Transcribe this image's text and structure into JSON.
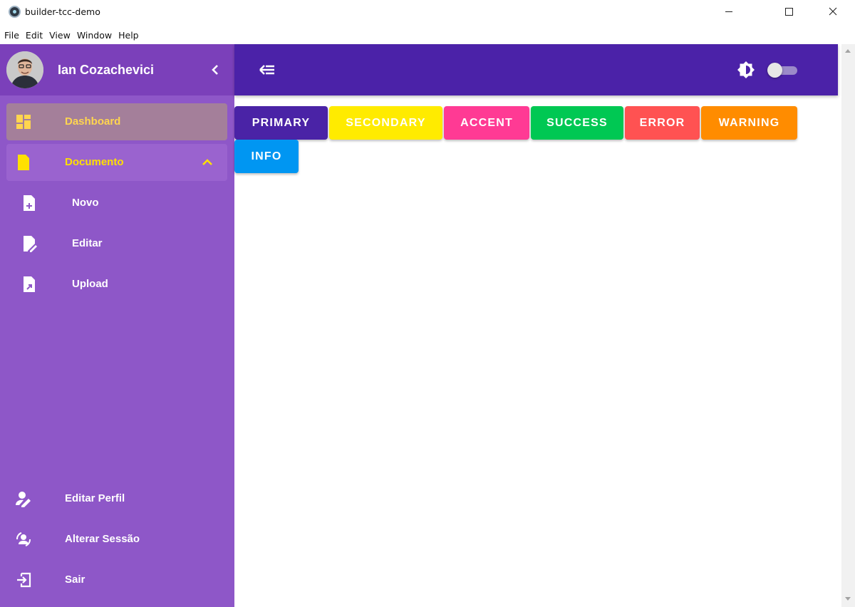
{
  "window": {
    "title": "builder-tcc-demo",
    "icon": "electron-icon"
  },
  "menubar": {
    "items": [
      "File",
      "Edit",
      "View",
      "Window",
      "Help"
    ]
  },
  "sidebar": {
    "user_name": "Ian Cozachevici",
    "items": [
      {
        "label": "Dashboard",
        "icon": "dashboard-icon",
        "state": "active"
      },
      {
        "label": "Documento",
        "icon": "document-icon",
        "state": "expanded"
      }
    ],
    "sub_items": [
      {
        "label": "Novo",
        "icon": "file-plus-icon"
      },
      {
        "label": "Editar",
        "icon": "file-edit-icon"
      },
      {
        "label": "Upload",
        "icon": "file-upload-icon"
      }
    ],
    "bottom_items": [
      {
        "label": "Editar Perfil",
        "icon": "user-edit-icon"
      },
      {
        "label": "Alterar Sessão",
        "icon": "switch-account-icon"
      },
      {
        "label": "Sair",
        "icon": "logout-icon"
      }
    ]
  },
  "appbar": {
    "menu_icon": "arrow-left-menu-icon",
    "theme_icon": "brightness-icon",
    "dark_mode_on": false
  },
  "buttons": [
    {
      "label": "PRIMARY",
      "color": "#4a23a6"
    },
    {
      "label": "SECONDARY",
      "color": "#ffeb00"
    },
    {
      "label": "ACCENT",
      "color": "#ff3a94"
    },
    {
      "label": "SUCCESS",
      "color": "#00c853"
    },
    {
      "label": "ERROR",
      "color": "#ff5252"
    },
    {
      "label": "WARNING",
      "color": "#ff8c00"
    },
    {
      "label": "INFO",
      "color": "#0096f2"
    }
  ],
  "colors": {
    "sidebar_bg": "#8e57c8",
    "sidebar_header_bg": "#7b40ba",
    "appbar_bg": "#4b22a8",
    "active_text": "#ffd54f",
    "group_text": "#ffe000"
  }
}
